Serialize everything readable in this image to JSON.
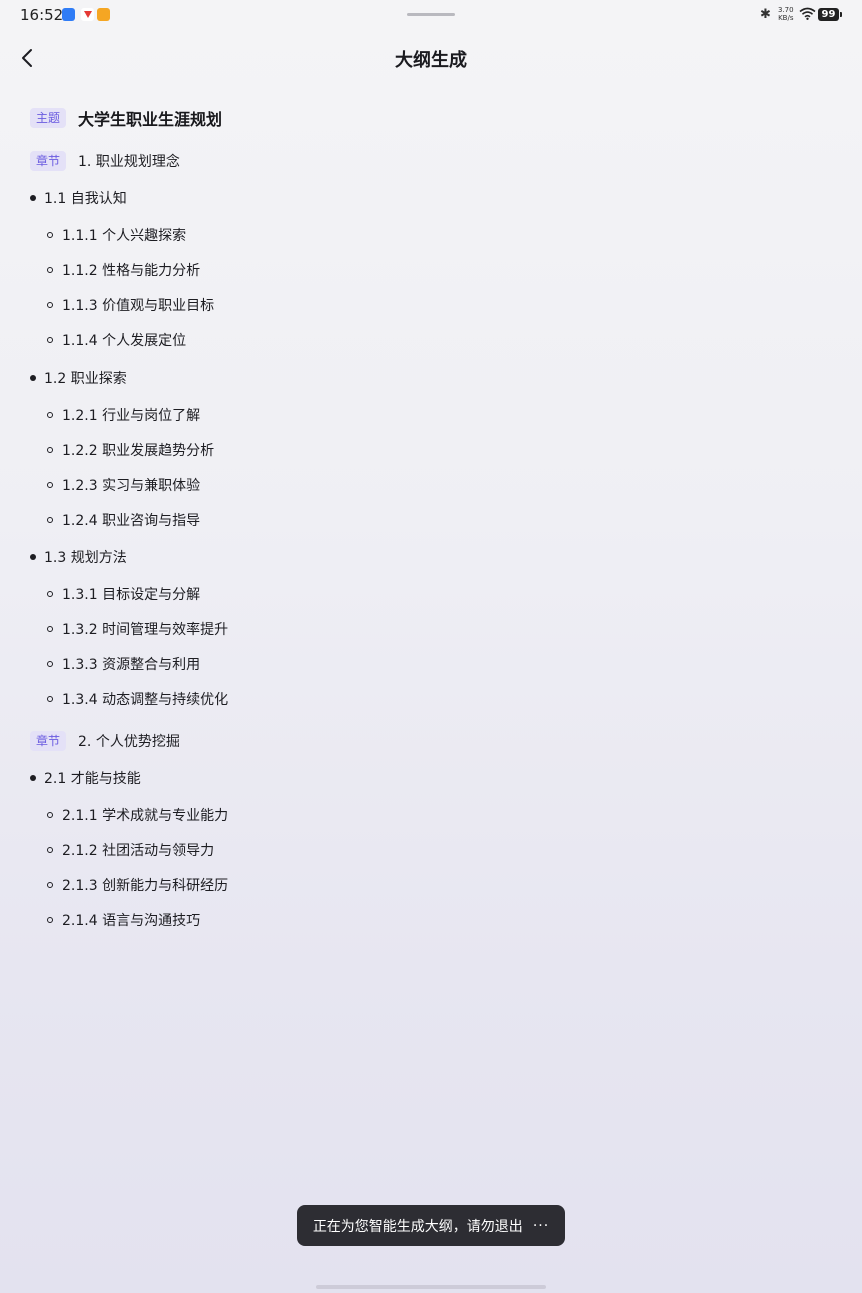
{
  "status_bar": {
    "time": "16:52",
    "net_speed_value": "3.70",
    "net_speed_unit": "KB/s",
    "battery": "99"
  },
  "header": {
    "title": "大纲生成"
  },
  "outline": {
    "topic_tag": "主题",
    "topic": "大学生职业生涯规划",
    "chapter_tag": "章节",
    "chapters": [
      {
        "title": "1. 职业规划理念",
        "sections": [
          {
            "title": "1.1 自我认知",
            "items": [
              "1.1.1 个人兴趣探索",
              "1.1.2 性格与能力分析",
              "1.1.3 价值观与职业目标",
              "1.1.4 个人发展定位"
            ]
          },
          {
            "title": "1.2 职业探索",
            "items": [
              "1.2.1 行业与岗位了解",
              "1.2.2 职业发展趋势分析",
              "1.2.3 实习与兼职体验",
              "1.2.4 职业咨询与指导"
            ]
          },
          {
            "title": "1.3 规划方法",
            "items": [
              "1.3.1 目标设定与分解",
              "1.3.2 时间管理与效率提升",
              "1.3.3 资源整合与利用",
              "1.3.4 动态调整与持续优化"
            ]
          }
        ]
      },
      {
        "title": "2. 个人优势挖掘",
        "sections": [
          {
            "title": "2.1 才能与技能",
            "items": [
              "2.1.1 学术成就与专业能力",
              "2.1.2 社团活动与领导力",
              "2.1.3 创新能力与科研经历",
              "2.1.4 语言与沟通技巧"
            ]
          }
        ]
      }
    ]
  },
  "toast": {
    "message": "正在为您智能生成大纲，请勿退出",
    "dots": "···"
  }
}
